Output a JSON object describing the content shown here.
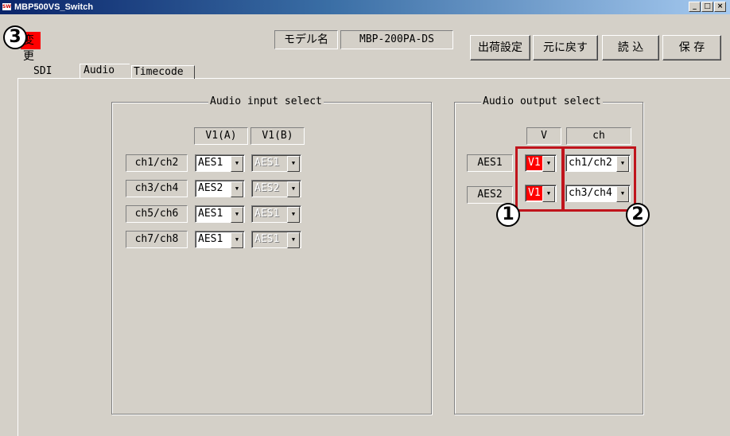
{
  "window": {
    "title": "MBP500VS_Switch",
    "icon_text": "SW",
    "controls": [
      "_",
      "□",
      "×"
    ]
  },
  "toolbar": {
    "change_label": "変更",
    "model_label": "モデル名",
    "model_value": "MBP-200PA-DS",
    "factory_label": "出荷設定",
    "revert_label": "元に戻す",
    "read_label": "読 込",
    "save_label": "保 存"
  },
  "tabs": [
    {
      "label": "SDI"
    },
    {
      "label": "Audio"
    },
    {
      "label": "Timecode"
    }
  ],
  "input_group": {
    "title": "Audio input select",
    "col_a": "V1(A)",
    "col_b": "V1(B)",
    "rows": [
      {
        "label": "ch1/ch2",
        "a": "AES1",
        "b": "AES1"
      },
      {
        "label": "ch3/ch4",
        "a": "AES2",
        "b": "AES2"
      },
      {
        "label": "ch5/ch6",
        "a": "AES1",
        "b": "AES1"
      },
      {
        "label": "ch7/ch8",
        "a": "AES1",
        "b": "AES1"
      }
    ]
  },
  "output_group": {
    "title": "Audio output select",
    "col_v": "V",
    "col_ch": "ch",
    "rows": [
      {
        "label": "AES1",
        "v": "V1",
        "ch": "ch1/ch2"
      },
      {
        "label": "AES2",
        "v": "V1",
        "ch": "ch3/ch4"
      }
    ]
  },
  "callouts": {
    "one": "1",
    "two": "2",
    "three": "3"
  },
  "colors": {
    "highlight": "#ff0000",
    "callout_frame": "#c0141c",
    "face": "#d4d0c8"
  }
}
